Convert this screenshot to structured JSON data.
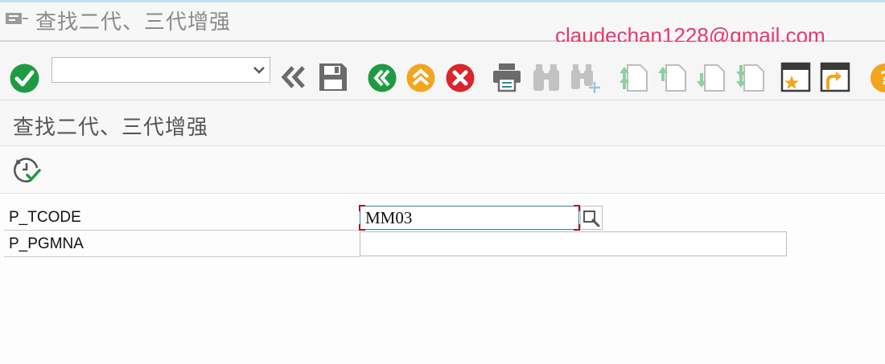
{
  "window": {
    "title": "查找二代、三代增强",
    "watermark": "claudechan1228@gmail.com"
  },
  "toolbar": {
    "command_field_value": "",
    "buttons": [
      "enter",
      "command-field-dropdown",
      "collapse",
      "save",
      "back",
      "exit",
      "cancel",
      "print",
      "find",
      "find-next",
      "first-page",
      "previous-page",
      "next-page",
      "last-page",
      "create-session",
      "generate-shortcut",
      "help"
    ]
  },
  "screen": {
    "title": "查找二代、三代增强"
  },
  "app_toolbar": {
    "buttons": [
      "execute"
    ]
  },
  "form": {
    "fields": [
      {
        "label": "P_TCODE",
        "value": "MM03"
      },
      {
        "label": "P_PGMNA",
        "value": ""
      }
    ]
  },
  "colors": {
    "enter_green": "#1e9b42",
    "back_green": "#1e9b42",
    "exit_orange": "#f2a51e",
    "cancel_red": "#d9252b",
    "focus_red": "#9c1a2c",
    "focus_teal": "#2a8aa0",
    "watermark_pink": "#e8376c"
  }
}
